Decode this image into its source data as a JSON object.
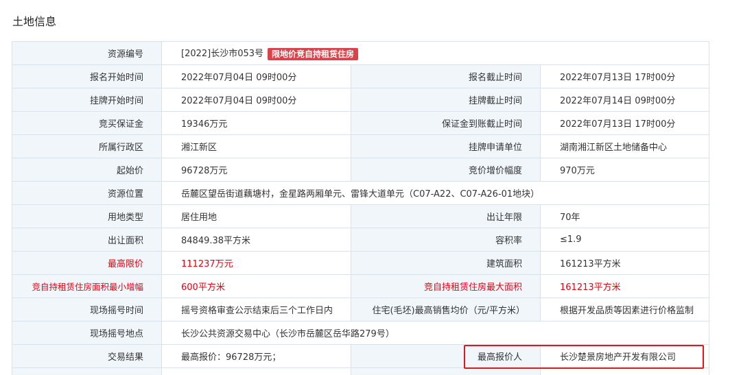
{
  "section_title": "土地信息",
  "resource": {
    "label": "资源编号",
    "value": "[2022]长沙市053号",
    "tag": "限地价竞自持租赁住房"
  },
  "rows": [
    {
      "l1": "报名开始时间",
      "v1": "2022年07月04日 09时00分",
      "l2": "报名截止时间",
      "v2": "2022年07月13日 17时00分"
    },
    {
      "l1": "挂牌开始时间",
      "v1": "2022年07月04日 09时00分",
      "l2": "挂牌截止时间",
      "v2": "2022年07月14日 09时00分"
    },
    {
      "l1": "竞买保证金",
      "v1": "19346万元",
      "l2": "保证金到账截止时间",
      "v2": "2022年07月13日 17时00分"
    },
    {
      "l1": "所属行政区",
      "v1": "湘江新区",
      "l2": "挂牌申请单位",
      "v2": "湖南湘江新区土地储备中心"
    },
    {
      "l1": "起始价",
      "v1": "96728万元",
      "l2": "竞价增价幅度",
      "v2": "970万元"
    }
  ],
  "location": {
    "label": "资源位置",
    "value": "岳麓区望岳街道藕塘村，金星路两厢单元、雷锋大道单元（C07-A22、C07-A26-01地块）"
  },
  "rows2": [
    {
      "l1": "用地类型",
      "v1": "居住用地",
      "l2": "出让年限",
      "v2": "70年"
    },
    {
      "l1": "出让面积",
      "v1": "84849.38平方米",
      "l2": "容积率",
      "v2": "≤1.9"
    },
    {
      "l1": "最高限价",
      "v1": "111237万元",
      "l2": "建筑面积",
      "v2": "161213平方米"
    },
    {
      "l1": "竞自持租赁住房面积最小增幅",
      "v1": "600平方米",
      "l2": "竞自持租赁住房最大面积",
      "v2": "161213平方米"
    },
    {
      "l1": "现场摇号时间",
      "v1": "摇号资格审查公示结束后三个工作日内",
      "l2": "住宅(毛坯)最高销售均价（元/平方米）",
      "v2": "根据开发品质等因素进行价格监制"
    }
  ],
  "venue": {
    "label": "现场摇号地点",
    "value": "长沙公共资源交易中心（长沙市岳麓区岳华路279号）"
  },
  "result": {
    "label": "交易结果",
    "value": "最高报价：96728万元；",
    "bidder_label": "最高报价人",
    "bidder_value": "长沙楚景房地产开发有限公司"
  },
  "colors": {
    "label_bg": "#f1f6fb",
    "border": "#d6e3ee",
    "red_text": "#e60012",
    "tag_bg": "#d9434a",
    "highlight_box": "#e3161a"
  }
}
